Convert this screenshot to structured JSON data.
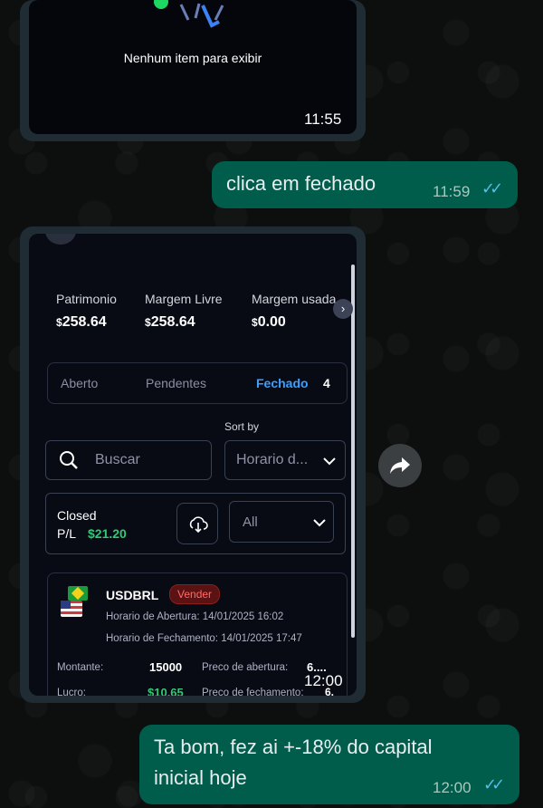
{
  "colors": {
    "incoming_bubble": "#1f2c33",
    "outgoing_bubble": "#005c4b",
    "read_ticks": "#53bdeb",
    "accent_blue": "#3aa0ff",
    "profit_green": "#2fca73",
    "sell_badge": "#6b1414"
  },
  "messages": {
    "image1": {
      "caption": "Nenhum item para exibir",
      "time": "11:55"
    },
    "out1": {
      "text": "clica em fechado",
      "time": "11:59"
    },
    "image2": {
      "time": "12:00",
      "summary": [
        {
          "label": "Patrimonio",
          "currency": "$",
          "value": "258.64"
        },
        {
          "label": "Margem Livre",
          "currency": "$",
          "value": "258.64"
        },
        {
          "label": "Margem usada",
          "currency": "$",
          "value": "0.00"
        }
      ],
      "tabs": {
        "open": "Aberto",
        "pending": "Pendentes",
        "closed": "Fechado",
        "closed_count": "4"
      },
      "sort_label": "Sort by",
      "search_placeholder": "Buscar",
      "sort_value": "Horario d...",
      "closed_label": "Closed",
      "pl_label": "P/L",
      "pl_value": "$21.20",
      "filter_value": "All",
      "trade": {
        "symbol": "USDBRL",
        "side": "Vender",
        "open_time": "Horario de Abertura: 14/01/2025 16:02",
        "close_time": "Horario de Fechamento: 14/01/2025 17:47",
        "amount_label": "Montante:",
        "amount_value": "15000",
        "open_price_label": "Preco de abertura:",
        "open_price_value": "6....",
        "profit_label": "Lucro:",
        "profit_value": "$10.65",
        "close_price_label": "Preco de fechamento:",
        "close_price_value": "6."
      }
    },
    "out2": {
      "text_line1": "Ta bom, fez ai +-18% do capital",
      "text_line2": "inicial hoje",
      "time": "12:00"
    }
  },
  "icons": [
    "forward-icon",
    "search-icon",
    "chevron-down-icon",
    "download-icon",
    "chevron-right-icon",
    "read-ticks-icon",
    "flag-icon"
  ]
}
